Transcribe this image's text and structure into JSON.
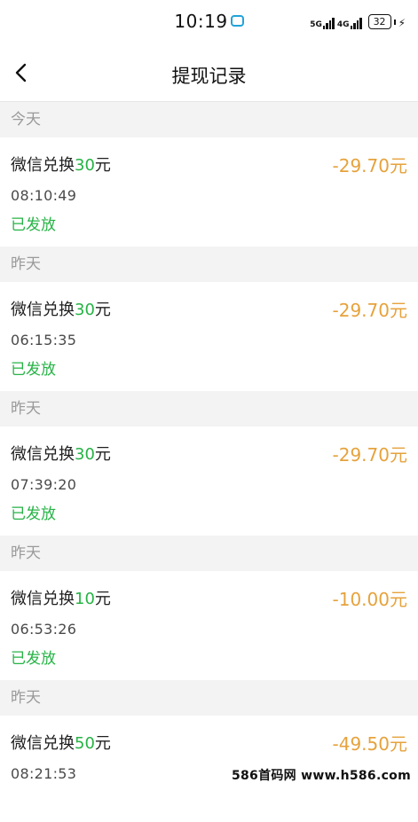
{
  "status_bar": {
    "time": "10:19",
    "net1": "5G",
    "net2": "4G",
    "battery": "32"
  },
  "header": {
    "title": "提现记录"
  },
  "sections": [
    {
      "label": "今天",
      "records": [
        {
          "title_prefix": "微信兑换",
          "title_amount": "30",
          "title_suffix": "元",
          "time": "08:10:49",
          "status": "已发放",
          "value": "-29.70元"
        }
      ]
    },
    {
      "label": "昨天",
      "records": [
        {
          "title_prefix": "微信兑换",
          "title_amount": "30",
          "title_suffix": "元",
          "time": "06:15:35",
          "status": "已发放",
          "value": "-29.70元"
        }
      ]
    },
    {
      "label": "昨天",
      "records": [
        {
          "title_prefix": "微信兑换",
          "title_amount": "30",
          "title_suffix": "元",
          "time": "07:39:20",
          "status": "已发放",
          "value": "-29.70元"
        }
      ]
    },
    {
      "label": "昨天",
      "records": [
        {
          "title_prefix": "微信兑换",
          "title_amount": "10",
          "title_suffix": "元",
          "time": "06:53:26",
          "status": "已发放",
          "value": "-10.00元"
        }
      ]
    },
    {
      "label": "昨天",
      "records": [
        {
          "title_prefix": "微信兑换",
          "title_amount": "50",
          "title_suffix": "元",
          "time": "08:21:53",
          "status": "",
          "value": "-49.50元"
        }
      ]
    }
  ],
  "watermark": "586首码网 www.h586.com",
  "colors": {
    "green": "#26b345",
    "orange": "#e6a23c",
    "section_bg": "#f3f3f3"
  }
}
